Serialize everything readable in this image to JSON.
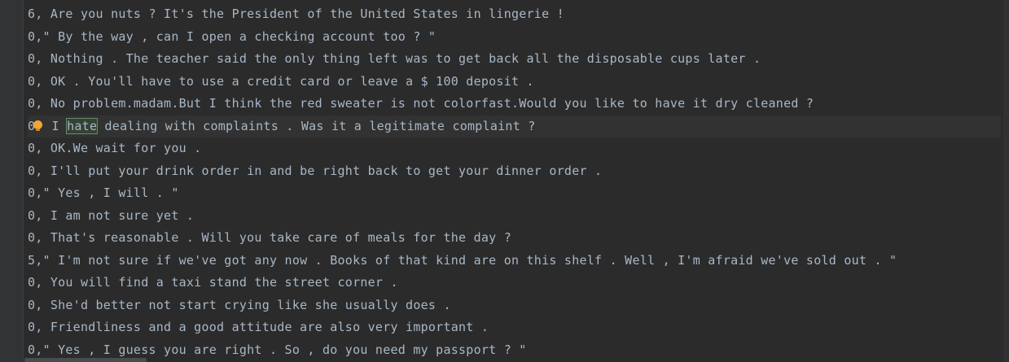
{
  "editor": {
    "lines": [
      "6, Are you nuts ? It's the President of the United States in lingerie !",
      "0,\" By the way , can I open a checking account too ? \"",
      "0, Nothing . The teacher said the only thing left was to get back all the disposable cups later .",
      "0, OK . You'll have to use a credit card or leave a $ 100 deposit .",
      "0, No problem.madam.But I think the red sweater is not colorfast.Would you like to have it dry cleaned ?",
      {
        "prefix": "0",
        "after_bulb": " I ",
        "highlight": "hate",
        "suffix": " dealing with complaints . Was it a legitimate complaint ?"
      },
      "0, OK.We wait for you .",
      "0, I'll put your drink order in and be right back to get your dinner order .",
      "0,\" Yes , I will . \"",
      "0, I am not sure yet .",
      "0, That's reasonable . Will you take care of meals for the day ?",
      "5,\" I'm not sure if we've got any now . Books of that kind are on this shelf . Well , I'm afraid we've sold out . \"",
      "0, You will find a taxi stand the street corner .",
      "0, She'd better not start crying like she usually does .",
      "0, Friendliness and a good attitude are also very important .",
      "0,\" Yes , I guess you are right . So , do you need my passport ? \""
    ],
    "intention_icon": "lightbulb-icon",
    "colors": {
      "background": "#2b2b2b",
      "text": "#a9b7c6",
      "highlight_bg": "#344134",
      "bulb": "#f0a732"
    }
  }
}
